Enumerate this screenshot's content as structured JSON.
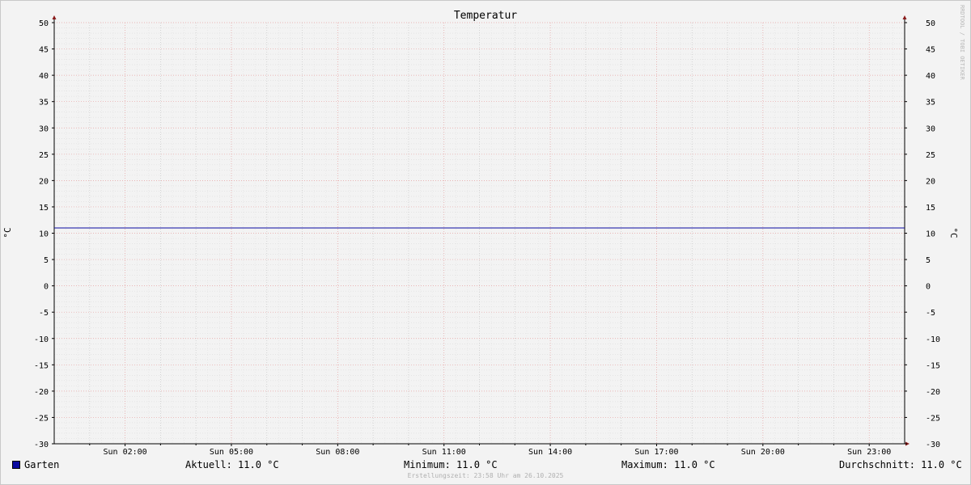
{
  "chart_data": {
    "type": "line",
    "title": "Temperatur",
    "ylabel": "°C",
    "ylabel_right": "°C",
    "ylim": [
      -30,
      50
    ],
    "y_ticks": [
      "-30",
      "-25",
      "-20",
      "-15",
      "-10",
      "-5",
      "0",
      "5",
      "10",
      "15",
      "20",
      "25",
      "30",
      "35",
      "40",
      "45",
      "50"
    ],
    "x_ticks": [
      "Sun 02:00",
      "Sun 05:00",
      "Sun 08:00",
      "Sun 11:00",
      "Sun 14:00",
      "Sun 17:00",
      "Sun 20:00",
      "Sun 23:00"
    ],
    "x_tick_hours": [
      2,
      5,
      8,
      11,
      14,
      17,
      20,
      23
    ],
    "xlim_hours": [
      0,
      24
    ],
    "grid": true,
    "series": [
      {
        "name": "Garten",
        "color": "#0a0aa0",
        "x": [
          0,
          24
        ],
        "y": [
          11.0,
          11.0
        ]
      }
    ]
  },
  "watermark": "RRDTOOL / TOBI OETIKER",
  "legend": {
    "series_name": "Garten",
    "current": "Aktuell: 11.0 °C",
    "minimum": "Minimum: 11.0 °C",
    "maximum": "Maximum: 11.0 °C",
    "average": "Durchschnitt: 11.0 °C"
  },
  "footer": "Erstellungszeit: 23:58 Uhr am 26.10.2025"
}
